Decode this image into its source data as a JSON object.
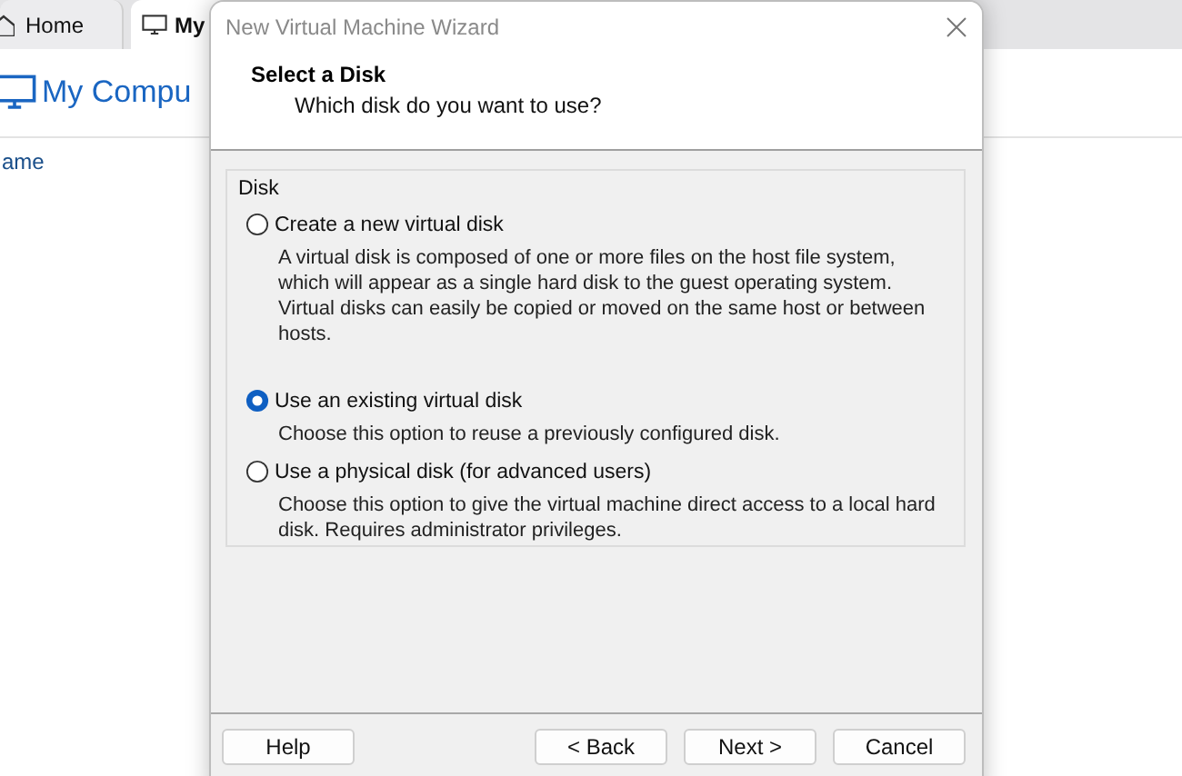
{
  "background": {
    "tabs": [
      {
        "label": "Home",
        "selected": false
      },
      {
        "label": "My",
        "selected": true
      }
    ],
    "heading": "My Compu",
    "column_header": "ame"
  },
  "dialog": {
    "title": "New Virtual Machine Wizard",
    "header_title": "Select a Disk",
    "header_subtitle": "Which disk do you want to use?",
    "group_label": "Disk",
    "options": [
      {
        "label": "Create a new virtual disk",
        "description": "A virtual disk is composed of one or more files on the host file system, which will appear as a single hard disk to the guest operating system. Virtual disks can easily be copied or moved on the same host or between hosts.",
        "selected": false
      },
      {
        "label": "Use an existing virtual disk",
        "description": "Choose this option to reuse a previously configured disk.",
        "selected": true
      },
      {
        "label": "Use a physical disk (for advanced users)",
        "description": "Choose this option to give the virtual machine direct access to a local hard disk. Requires administrator privileges.",
        "selected": false
      }
    ],
    "buttons": [
      "Help",
      "< Back",
      "Next >",
      "Cancel"
    ]
  }
}
